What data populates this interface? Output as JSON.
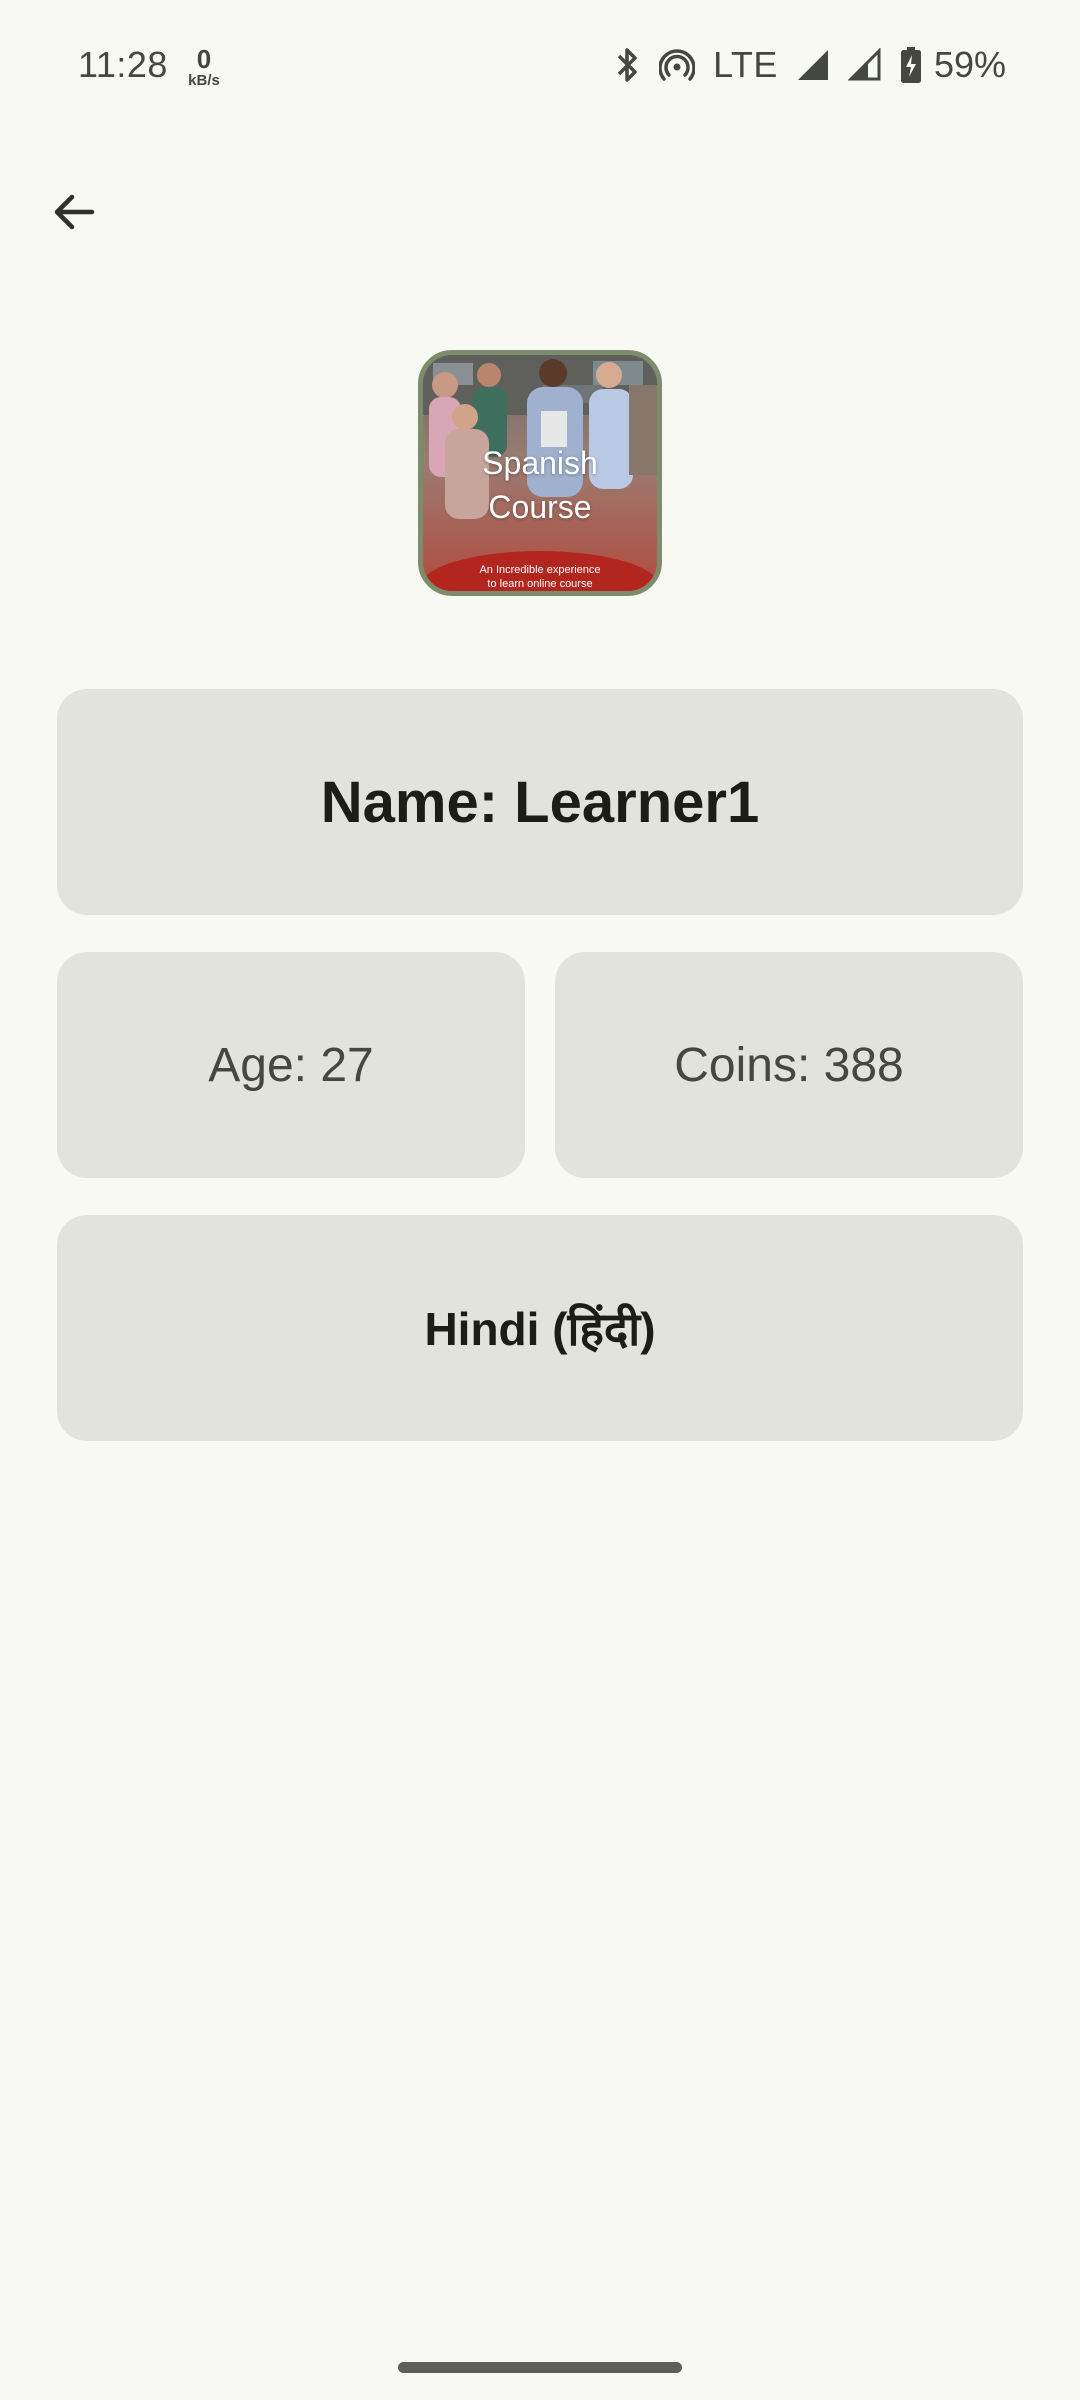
{
  "status_bar": {
    "time": "11:28",
    "net_speed_value": "0",
    "net_speed_unit": "kB/s",
    "icons": [
      "bluetooth-icon",
      "hotspot-icon",
      "signal-icon",
      "signal-icon",
      "battery-charging-icon"
    ],
    "network_type": "LTE",
    "battery_percent": "59%"
  },
  "app_bar": {
    "back_icon": "arrow-left-icon"
  },
  "course": {
    "title_line1": "Spanish",
    "title_line2": "Course",
    "subtitle_line1": "An Incredible experience",
    "subtitle_line2": "to learn online course"
  },
  "profile": {
    "name": "Name: Learner1",
    "age": "Age: 27",
    "coins": "Coins: 388",
    "language": "Hindi (हिंदी)"
  },
  "colors": {
    "background": "#f8f9f2",
    "card": "#e2e3dc",
    "image_border": "#7d8d6c",
    "text_primary": "#1c1c18",
    "text_secondary": "#45483f"
  }
}
